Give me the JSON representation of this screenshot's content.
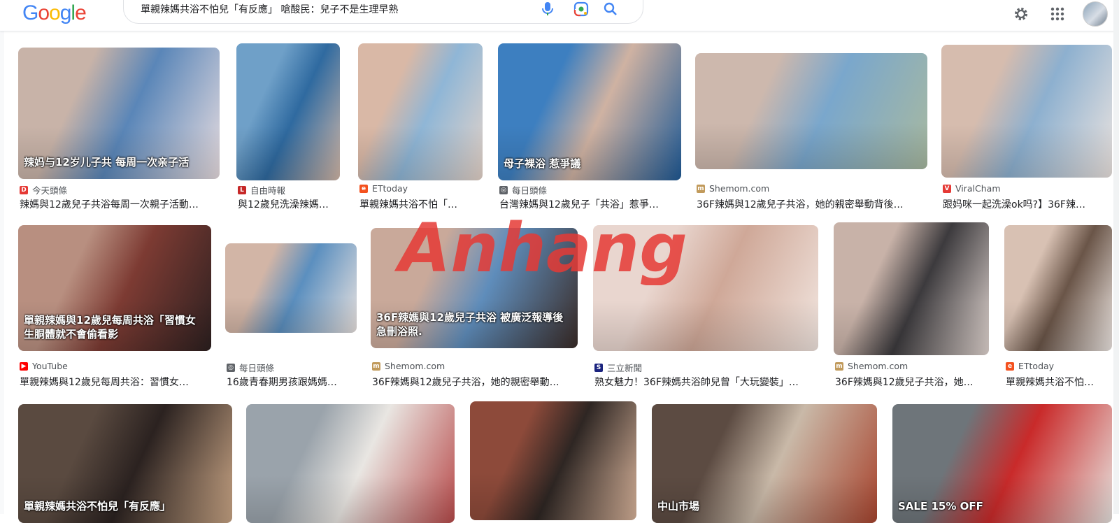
{
  "header": {
    "logo": [
      "G",
      "o",
      "o",
      "g",
      "l",
      "e"
    ],
    "search_value": "單親辣媽共浴不怕兒「有反應」 嗆酸民：兒子不是生理早熟",
    "icons": [
      "microphone-icon",
      "lens-icon",
      "search-icon",
      "gear-icon",
      "apps-grid-icon",
      "avatar"
    ]
  },
  "watermark_text": "Anhang",
  "results": [
    {
      "source": "今天頭條",
      "favicon": "D",
      "favicon_color": "#e53935",
      "title": "辣媽與12歲兒子共浴每周一次親子活動…",
      "thumb_colors": [
        "#c8b3a8",
        "#5a86b8",
        "#e8dde0"
      ],
      "thumb_text": "辣妈与12岁儿子共 每周一次亲子活"
    },
    {
      "source": "自由時報",
      "favicon": "L",
      "favicon_color": "#c62828",
      "title": "與12歲兒洗澡辣媽…",
      "thumb_colors": [
        "#6fa0c8",
        "#2f6aa0",
        "#d3b8a8"
      ],
      "thumb_text": ""
    },
    {
      "source": "ETtoday",
      "favicon": "e",
      "favicon_color": "#f4511e",
      "title": "單親辣媽共浴不怕「…",
      "thumb_colors": [
        "#d9b8a6",
        "#8fb6d6",
        "#e6d4c9"
      ],
      "thumb_text": ""
    },
    {
      "source": "每日頭條",
      "favicon": "◎",
      "favicon_color": "#5f6368",
      "title": "台灣辣媽與12歲兒子「共浴」惹爭…",
      "thumb_colors": [
        "#3d7fc0",
        "#cfb2a2",
        "#1f5a96"
      ],
      "thumb_text": "母子裸浴 惹爭議"
    },
    {
      "source": "Shemom.com",
      "favicon": "m",
      "favicon_color": "#c19a5b",
      "title": "36F辣媽與12歲兒子共浴，她的親密舉動背後…",
      "thumb_colors": [
        "#cdb8ad",
        "#7aa7cc",
        "#a8b9a0"
      ],
      "thumb_text": ""
    },
    {
      "source": "ViralCham",
      "favicon": "V",
      "favicon_color": "#e53935",
      "title": "跟妈咪一起洗澡ok吗?】36F辣妈…",
      "thumb_colors": [
        "#d6bcae",
        "#8db0cf",
        "#ece4e0"
      ],
      "thumb_text": ""
    },
    {
      "source": "YouTube",
      "favicon": "▶",
      "favicon_color": "#ff0000",
      "title": "單親辣媽與12歲兒每周共浴：習慣女…",
      "thumb_colors": [
        "#b88f80",
        "#7d3b33",
        "#2d2020"
      ],
      "thumb_text": "單親辣媽與12歲兒每周共浴「習慣女生胴體就不會偷看影"
    },
    {
      "source": "每日頭條",
      "favicon": "◎",
      "favicon_color": "#5f6368",
      "title": "16歲青春期男孩跟媽媽…",
      "thumb_colors": [
        "#d2b5a6",
        "#5b8fbf",
        "#e9e2df"
      ],
      "thumb_text": ""
    },
    {
      "source": "Shemom.com",
      "favicon": "m",
      "favicon_color": "#c19a5b",
      "title": "36F辣媽與12歲兒子共浴，她的親密舉動…",
      "thumb_colors": [
        "#c9a99a",
        "#5f8dbb",
        "#3a2c28"
      ],
      "thumb_text": "36F辣媽與12歲兒子共浴 被廣泛報導後急刪浴照."
    },
    {
      "source": "三立新聞",
      "favicon": "S",
      "favicon_color": "#1a237e",
      "title": "熟女魅力！36F辣媽共浴帥兒曾「大玩變裝」…",
      "thumb_colors": [
        "#e9d6cf",
        "#cfa898",
        "#f2e6e0"
      ],
      "thumb_text": ""
    },
    {
      "source": "Shemom.com",
      "favicon": "m",
      "favicon_color": "#c19a5b",
      "title": "36F辣媽與12歲兒子共浴，她…",
      "thumb_colors": [
        "#c8b2a8",
        "#3c3a3d",
        "#e3d7d2"
      ],
      "thumb_text": ""
    },
    {
      "source": "ETtoday",
      "favicon": "e",
      "favicon_color": "#f4511e",
      "title": "單親辣媽共浴不怕…",
      "thumb_colors": [
        "#d8c1b3",
        "#6a5548",
        "#efe8e4"
      ],
      "thumb_text": ""
    },
    {
      "source": "",
      "favicon": "",
      "favicon_color": "#ffffff",
      "title": "",
      "thumb_colors": [
        "#5a4a40",
        "#2b2220",
        "#c9a585"
      ],
      "thumb_text": "單親辣媽共浴不怕兒「有反應」"
    },
    {
      "source": "",
      "favicon": "",
      "favicon_color": "#ffffff",
      "title": "",
      "thumb_colors": [
        "#9aa3ab",
        "#e9e6e2",
        "#b84a4a"
      ],
      "thumb_text": ""
    },
    {
      "source": "",
      "favicon": "",
      "favicon_color": "#ffffff",
      "title": "",
      "thumb_colors": [
        "#8d4a3a",
        "#2e2623",
        "#d9b49b"
      ],
      "thumb_text": ""
    },
    {
      "source": "",
      "favicon": "",
      "favicon_color": "#ffffff",
      "title": "",
      "thumb_colors": [
        "#5c4b42",
        "#c9b9a8",
        "#a8442e"
      ],
      "thumb_text": "中山市場"
    },
    {
      "source": "",
      "favicon": "",
      "favicon_color": "#ffffff",
      "title": "",
      "thumb_colors": [
        "#6e757a",
        "#c92a2a",
        "#e7e3df"
      ],
      "thumb_text": "SALE 15% OFF"
    }
  ]
}
